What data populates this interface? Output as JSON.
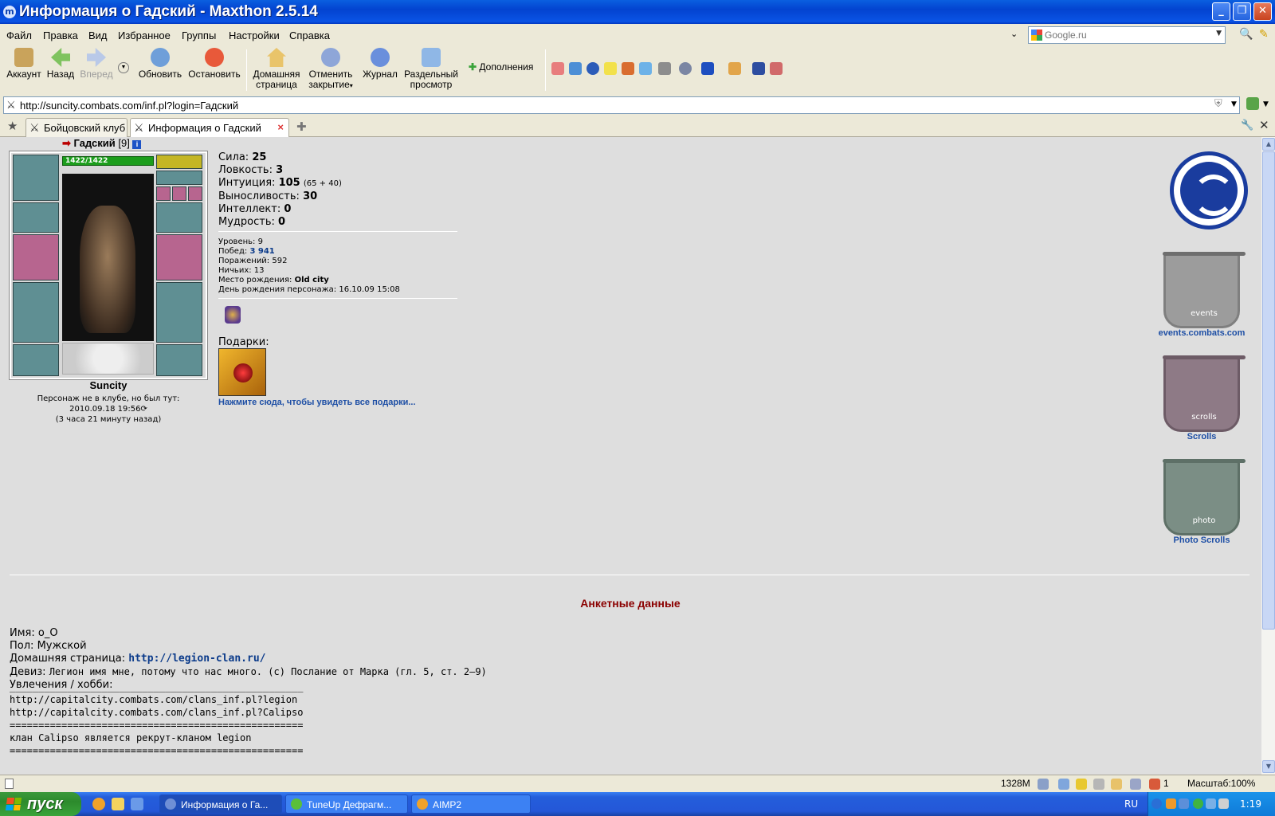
{
  "window": {
    "title": "Информация о Гадский - Maxthon 2.5.14",
    "app_icon": "m",
    "controls": [
      "minimize",
      "maximize",
      "close"
    ]
  },
  "menu": [
    "Файл",
    "Правка",
    "Вид",
    "Избранное",
    "Группы",
    "Настройки",
    "Справка"
  ],
  "search": {
    "placeholder": "Google.ru"
  },
  "toolbar": {
    "account": "Аккаунт",
    "back": "Назад",
    "forward": "Вперед",
    "refresh": "Обновить",
    "stop": "Остановить",
    "home_1": "Домашняя",
    "home_2": "страница",
    "undo_1": "Отменить",
    "undo_2": "закрытие",
    "history": "Журнал",
    "split_1": "Раздельный",
    "split_2": "просмотр",
    "addons": "Дополнения"
  },
  "address": {
    "url": "http://suncity.combats.com/inf.pl?login=Гадский"
  },
  "tabs": [
    {
      "label": "Бойцовский клуб"
    },
    {
      "label": "Информация о Гадский"
    }
  ],
  "character": {
    "name": "Гадский",
    "level": "[9]",
    "info_icon": "i",
    "hp": "1422/1422",
    "city": "Suncity",
    "status_1": "Персонаж не в клубе, но был тут:",
    "status_2": "2010.09.18 19:56",
    "status_3": "(3 часа 21 минуту назад)"
  },
  "stats": [
    {
      "label": "Сила:",
      "value": "25",
      "extra": ""
    },
    {
      "label": "Ловкость:",
      "value": "3",
      "extra": ""
    },
    {
      "label": "Интуиция:",
      "value": "105",
      "extra": "(65 + 40)"
    },
    {
      "label": "Выносливость:",
      "value": "30",
      "extra": ""
    },
    {
      "label": "Интеллект:",
      "value": "0",
      "extra": ""
    },
    {
      "label": "Мудрость:",
      "value": "0",
      "extra": ""
    }
  ],
  "info": {
    "level_label": "Уровень:",
    "level_value": "9",
    "wins_label": "Побед:",
    "wins_value": "3 941",
    "losses_label": "Поражений:",
    "losses_value": "592",
    "draws_label": "Ничьих:",
    "draws_value": "13",
    "birthplace_label": "Место рождения:",
    "birthplace_value": "Old city",
    "birthday_label": "День рождения персонажа:",
    "birthday_value": "16.10.09 15:08"
  },
  "gifts": {
    "label": "Подарки:",
    "link": "Нажмите сюда, чтобы увидеть все подарки..."
  },
  "sidebar": {
    "events_label": "events",
    "events_link": "events.combats.com",
    "scrolls_label": "scrolls",
    "scrolls_link": "Scrolls",
    "photo_label": "photo",
    "photo_link": "Photo Scrolls"
  },
  "profile": {
    "title": "Анкетные данные",
    "name_label": "Имя:",
    "name_value": "o_O",
    "gender_label": "Пол:",
    "gender_value": "Мужской",
    "home_label": "Домашняя страница:",
    "home_value": "http://legion-clan.ru/",
    "motto_label": "Девиз:",
    "motto_value": "Легион имя мне, потому что нас много. (с) Послание от Марка (гл. 5, ст. 2—9)",
    "hobby_label": "Увлечения / хобби:",
    "hobby_text": "___________________________________________________\nhttp://capitalcity.combats.com/clans_inf.pl?legion\nhttp://capitalcity.combats.com/clans_inf.pl?Calipso\n===================================================\nклан Calipso является рекрут-кланом legion\n==================================================="
  },
  "statusbar": {
    "memory": "1328M",
    "tab_count": "1",
    "zoom": "Масштаб:100%"
  },
  "taskbar": {
    "start": "пуск",
    "tasks": [
      "Информация о Га...",
      "TuneUp Дефрагм...",
      "AIMP2"
    ],
    "lang": "RU",
    "clock": "1:19"
  },
  "colors": {
    "titlebar": "#0a54e5",
    "link": "#1e4fa5",
    "profile_title": "#8b0000",
    "hp": "#1c9d1c"
  }
}
